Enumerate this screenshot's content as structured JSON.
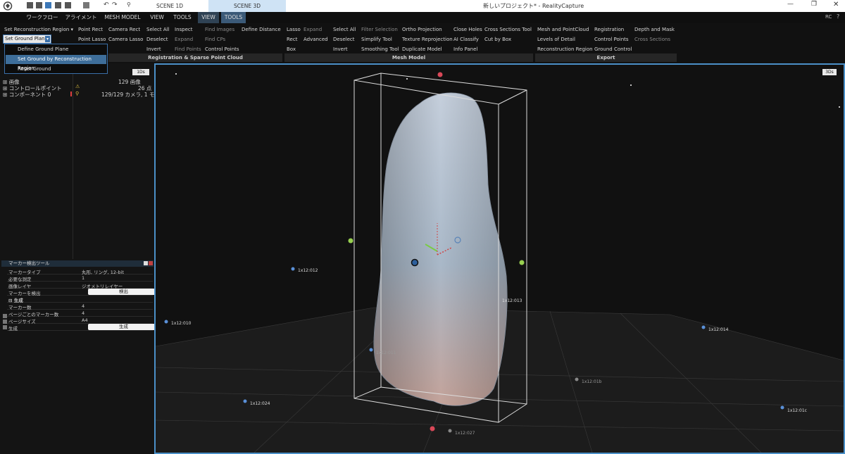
{
  "window": {
    "title": "新しいプロジェクト* - RealityCapture",
    "scene_tabs": [
      "SCENE 1D",
      "SCENE 3D"
    ],
    "rc_label": "RC"
  },
  "menu": {
    "items": [
      "ワークフロー",
      "アライメント",
      "MESH MODEL",
      "VIEW",
      "TOOLS",
      "VIEW",
      "TOOLS"
    ]
  },
  "ribbon": {
    "recon_region": "Set Reconstruction Region",
    "ground_plane": "Set Ground Plane",
    "col_point": [
      "Point Rect",
      "Point Lasso"
    ],
    "col_camera": [
      "Camera Rect",
      "Camera Lasso"
    ],
    "col_sel": [
      "Select All",
      "Deselect",
      "Invert"
    ],
    "col_inspect": [
      "Inspect",
      "Expand",
      "Find Points"
    ],
    "col_find": [
      "Find Images",
      "Find CPs",
      "Control Points"
    ],
    "define_distance": "Define Distance",
    "col_lasso": [
      "Lasso",
      "Rect",
      "Box"
    ],
    "col_expand": [
      "Expand",
      "Advanced"
    ],
    "col_sel2": [
      "Select All",
      "Deselect",
      "Invert"
    ],
    "col_filter": [
      "Filter Selection",
      "Simplify Tool",
      "Smoothing Tool"
    ],
    "col_ortho": [
      "Ortho Projection",
      "Texture Reprojection",
      "Duplicate Model"
    ],
    "col_close": [
      "Close Holes",
      "AI Classify",
      "Info Panel"
    ],
    "col_cross": [
      "Cross Sections Tool",
      "Cut by Box"
    ],
    "col_mesh": [
      "Mesh and PointCloud",
      "Levels of Detail",
      "Reconstruction Region"
    ],
    "col_reg": [
      "Registration",
      "Control Points",
      "Ground Control"
    ],
    "col_depth": [
      "Depth and Mask",
      "Cross Sections"
    ],
    "groups": [
      "Registration & Sparse Point Cloud",
      "Mesh Model",
      "Export"
    ]
  },
  "dropdown": {
    "items": [
      "Define Ground Plane",
      "Set Ground by Reconstruction Region",
      "Reset Ground"
    ]
  },
  "tree": {
    "badge": "1Ds",
    "rows": [
      {
        "label": "画像",
        "value": "129 画像"
      },
      {
        "label": "コントロールポイント",
        "value": "26 点"
      },
      {
        "label": "コンポーネント 0",
        "value": "129/129 カメラ, 1 モデル"
      }
    ]
  },
  "marker_tool": {
    "title": "マーカー検出ツール",
    "rows": [
      {
        "k": "マーカータイプ",
        "v": "丸形, リング, 12-bit"
      },
      {
        "k": "必要な測定",
        "v": "1"
      },
      {
        "k": "画像レイヤ",
        "v": "ジオメトリレイヤー"
      },
      {
        "k": "マーカーを検出",
        "v": "検出"
      },
      {
        "k": "生成",
        "v": ""
      },
      {
        "k": "マーカー数",
        "v": "4"
      },
      {
        "k": "ページごとのマーカー数",
        "v": "4"
      },
      {
        "k": "ページサイズ",
        "v": "A4"
      },
      {
        "k": "生成",
        "v": "生成"
      }
    ]
  },
  "viewport": {
    "badge": "3Ds",
    "markers": [
      "1x12:012",
      "1x12:013",
      "1x12:010",
      "1x12:014",
      "1x12:011",
      "1x12:01b",
      "1x12:024",
      "1x12:01c",
      "1x12:027"
    ]
  }
}
